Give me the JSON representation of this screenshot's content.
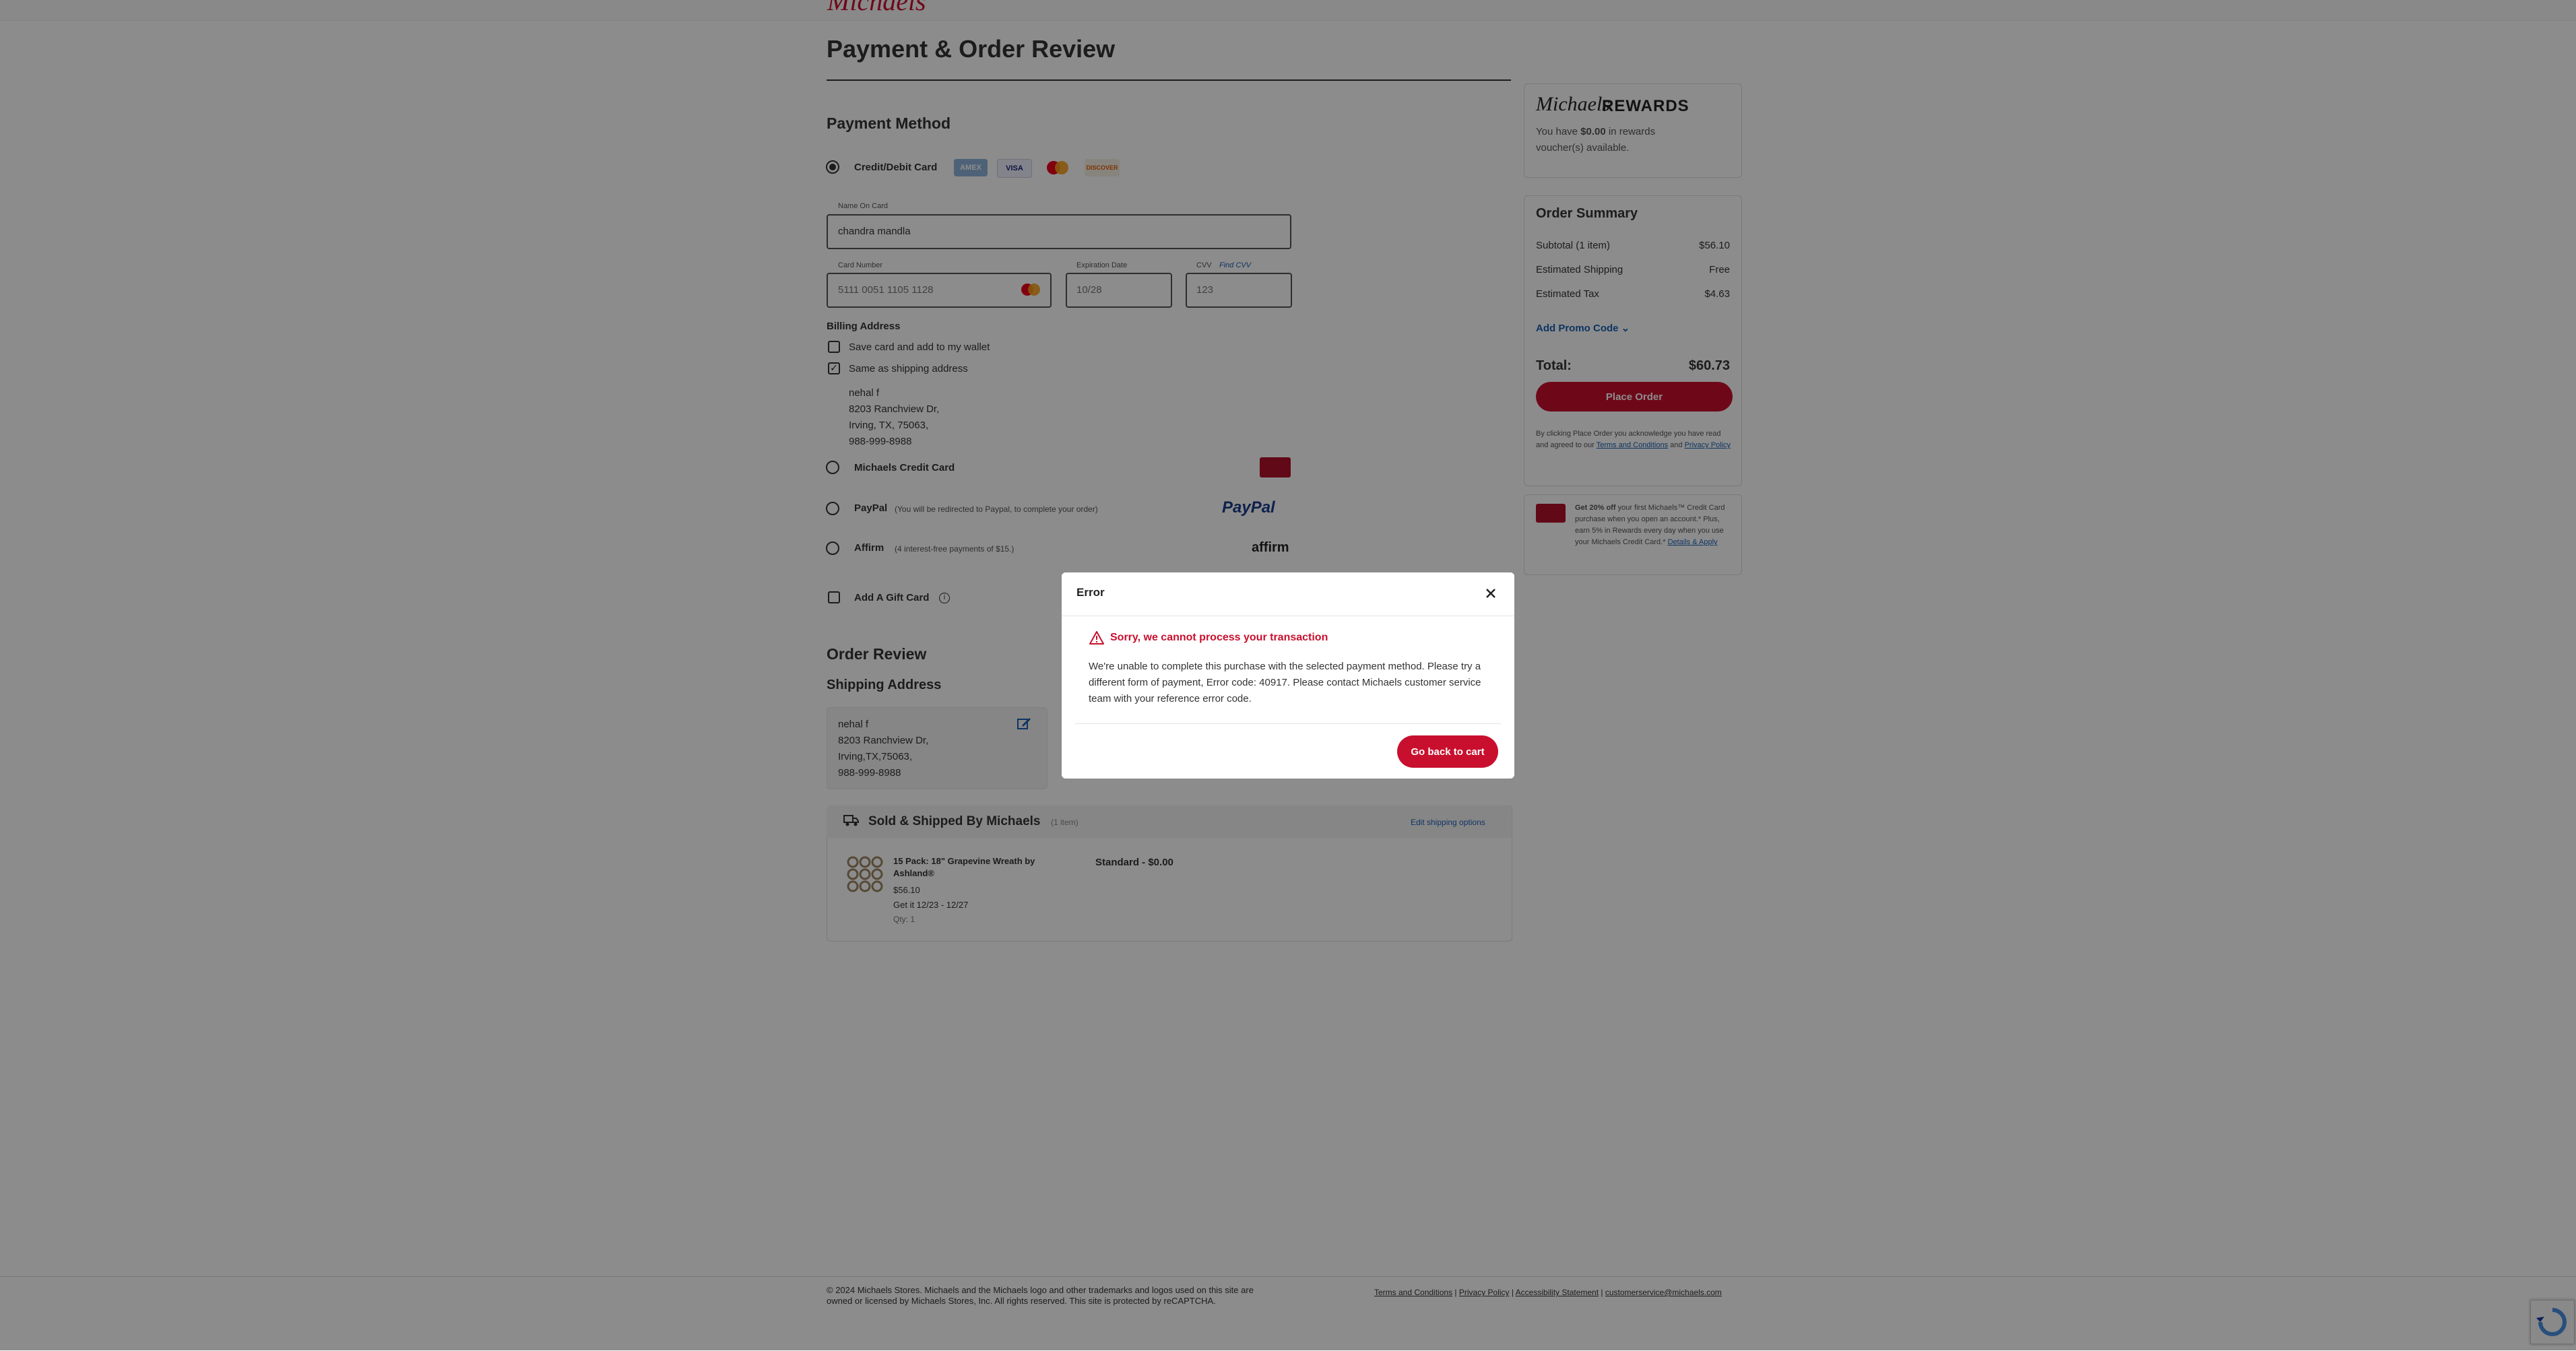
{
  "header": {
    "brand": "Michaels"
  },
  "page_title": "Payment & Order Review",
  "payment": {
    "section_title": "Payment Method",
    "credit_label": "Credit/Debit Card",
    "card_brands": [
      "AMEX",
      "VISA",
      "MC",
      "DISCOVER"
    ],
    "name_label": "Name On Card",
    "name_value": "chandra mandla",
    "number_label": "Card Number",
    "number_value": "5111 0051 1105 1128",
    "exp_label": "Expiration Date",
    "exp_value": "10/28",
    "cvv_label": "CVV",
    "cvv_hint": "Find CVV",
    "cvv_value": "123",
    "billing_title": "Billing Address",
    "save_card_label": "Save card and add to my wallet",
    "same_shipping_label": "Same as shipping address",
    "address_lines": [
      "nehal f",
      "8203 Ranchview Dr,",
      "Irving, TX, 75063,",
      "988-999-8988"
    ],
    "michaels_card_label": "Michaels Credit Card",
    "paypal_label": "PayPal",
    "paypal_note": "(You will be redirected to Paypal, to complete your order)",
    "paypal_logo": "PayPal",
    "affirm_label": "Affirm",
    "affirm_note": "(4 interest-free payments of $15.)",
    "affirm_logo": "affirm",
    "gift_label": "Add A Gift Card"
  },
  "review": {
    "title": "Order Review",
    "shipping_title": "Shipping Address",
    "ship_lines": [
      "nehal f",
      "8203 Ranchview Dr,",
      "Irving,TX,75063,",
      "988-999-8988"
    ],
    "sold_title": "Sold & Shipped By Michaels",
    "sold_count": "(1 item)",
    "edit_shipping": "Edit shipping options",
    "item_name": "15 Pack: 18\" Grapevine Wreath by Ashland®",
    "item_price": "$56.10",
    "item_eta": "Get it 12/23 - 12/27",
    "item_qty": "Qty: 1",
    "shipping_option": "Standard - $0.00"
  },
  "rewards": {
    "brand": "Michaels",
    "word": "REWARDS",
    "text_pre": "You have",
    "amount": "$0.00",
    "text_post": "in rewards voucher(s) available."
  },
  "summary": {
    "title": "Order Summary",
    "rows": [
      {
        "label": "Subtotal (1 item)",
        "value": "$56.10"
      },
      {
        "label": "Estimated Shipping",
        "value": "Free"
      },
      {
        "label": "Estimated Tax",
        "value": "$4.63"
      }
    ],
    "promo": "Add Promo Code",
    "total_label": "Total:",
    "total_value": "$60.73",
    "place_order": "Place Order",
    "legal_pre": "By clicking Place Order you acknowledge you have read and agreed to our",
    "terms": "Terms and Conditions",
    "and": "and",
    "privacy": "Privacy Policy"
  },
  "promo_card": {
    "bold": "Get 20% off",
    "text": "your first Michaels™ Credit Card purchase when you open an account.* Plus, earn 5% in Rewards every day when you use your Michaels Credit Card.*",
    "link": "Details & Apply"
  },
  "modal": {
    "title": "Error",
    "alert": "Sorry, we cannot process your transaction",
    "body": "We're unable to complete this purchase with the selected payment method. Please try a different form of payment, Error code: 40917. Please contact Michaels customer service team with your reference error code.",
    "button": "Go back to cart"
  },
  "footer": {
    "copyright": "© 2024 Michaels Stores. Michaels and the Michaels logo and other trademarks and logos used on this site are owned or licensed by Michaels Stores, Inc. All rights reserved. This site is protected by reCAPTCHA.",
    "links": [
      "Terms and Conditions",
      "Privacy Policy",
      "Accessibility Statement",
      "customerservice@michaels.com"
    ]
  },
  "colors": {
    "brand_red": "#c8102e",
    "overlay": "rgba(0,0,0,0.45)"
  }
}
